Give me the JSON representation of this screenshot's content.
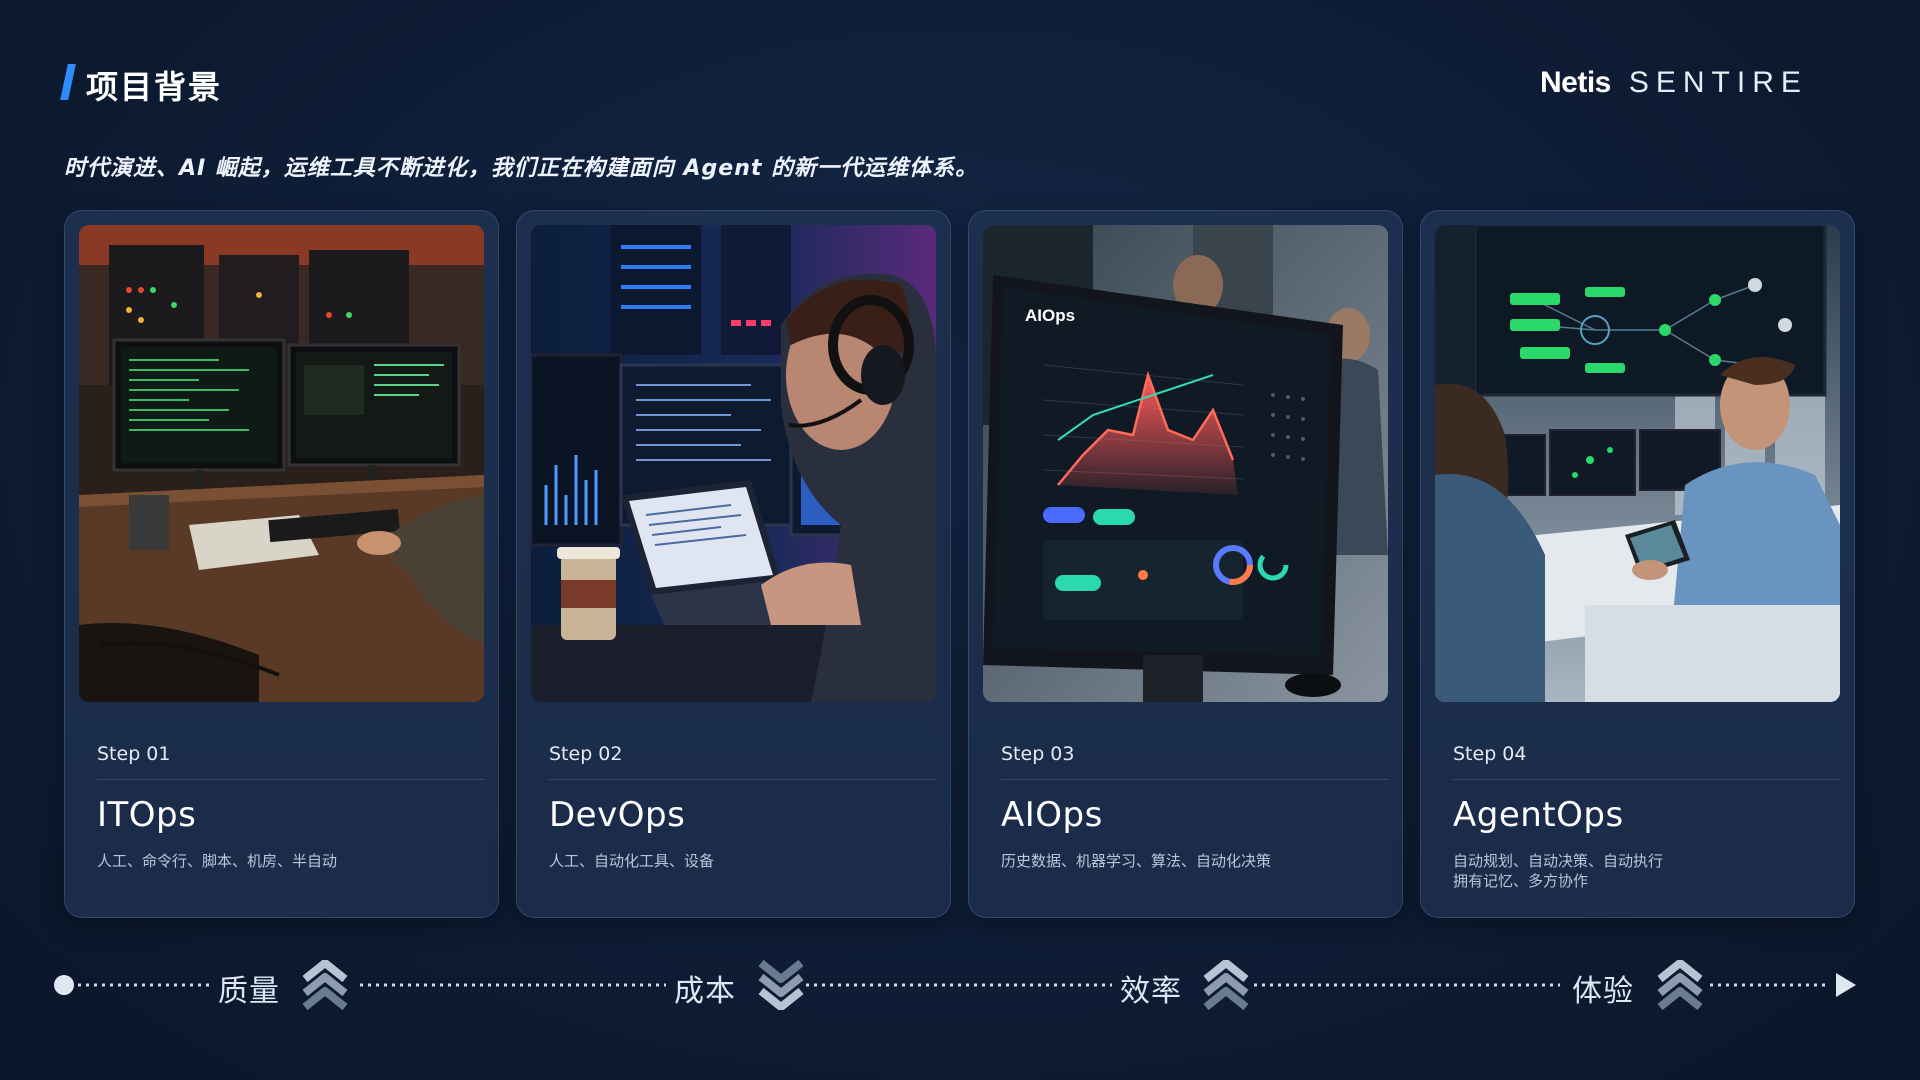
{
  "header": {
    "title": "项目背景",
    "logo_left": "Netis",
    "logo_right": "SENTIRE"
  },
  "subtitle": "时代演进、AI 崛起，运维工具不断进化，我们正在构建面向 Agent 的新一代运维体系。",
  "cards": [
    {
      "step": "Step 01",
      "title": "ITOps",
      "desc": "人工、命令行、脚本、机房、半自动"
    },
    {
      "step": "Step 02",
      "title": "DevOps",
      "desc": "人工、自动化工具、设备"
    },
    {
      "step": "Step 03",
      "title": "AIOps",
      "desc": "历史数据、机器学习、算法、自动化决策",
      "screen_brand": "AIOps"
    },
    {
      "step": "Step 04",
      "title": "AgentOps",
      "desc": "自动规划、自动决策、自动执行\n拥有记忆、多方协作"
    }
  ],
  "timeline": {
    "items": [
      {
        "label": "质量",
        "direction": "up"
      },
      {
        "label": "成本",
        "direction": "down"
      },
      {
        "label": "效率",
        "direction": "up"
      },
      {
        "label": "体验",
        "direction": "up"
      }
    ]
  },
  "colors": {
    "background": "#0e1d36",
    "card": "#1c2f4e",
    "accent": "#2f8cff"
  }
}
